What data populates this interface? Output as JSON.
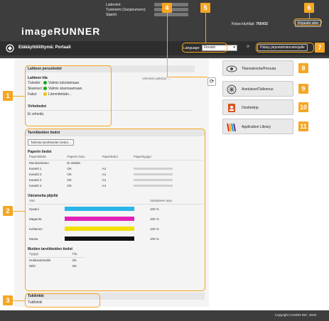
{
  "header": {
    "brand": "imageRUNNER",
    "device_info": [
      "Laitenimi:",
      "Tuotenimi (Sarjanumero):",
      "Sijainti:"
    ],
    "user_label": "Kirjaa käyttäjä:",
    "user_id": "765432",
    "logout_label": "Kirjaudu ulos",
    "portal_title": "Etäkäyttöliittymä: Portaali",
    "language_label": "Language:",
    "language_value": "Finnish",
    "help_label": "Pääsy järjestelmänvalvojalle",
    "refresh_label": "Viimeisin päivitys: ..."
  },
  "basic": {
    "title": "Laitteen perustiedot",
    "status_title": "Laitteen tila",
    "status": [
      {
        "name": "Tulostin:",
        "value": "Valmis tulostamaan.",
        "level": "ok"
      },
      {
        "name": "Skanneri:",
        "value": "Valmis skannaamaan.",
        "level": "ok"
      },
      {
        "name": "Faksi:",
        "value": "Lämmitetään...",
        "level": "warn"
      }
    ],
    "error_title": "Virhetiedot",
    "error_value": "Ei virheitä."
  },
  "supplies": {
    "title": "Tarvikkeiden tiedot",
    "check_button": "Tarkista tarvikkeiden tiedot...",
    "paper_title": "Paperin tiedot",
    "paper_headers": [
      "Paperilähde",
      "Paperin taso",
      "Paperikoko",
      "Paperityyppi"
    ],
    "paper_rows": [
      [
        "Monitoimitaso",
        "Ei mitään",
        "",
        ""
      ],
      [
        "Kasetti 1",
        "OK",
        "A4",
        ""
      ],
      [
        "Kasetti 2",
        "OK",
        "A4",
        ""
      ],
      [
        "Kasetti 3",
        "OK",
        "A4",
        ""
      ],
      [
        "Kasetti 4",
        "OK",
        "A4",
        ""
      ]
    ],
    "toner_title": "Väriainetta jäljellä",
    "toner_headers": [
      "Väri",
      "Väriaineen taso"
    ],
    "toner_rows": [
      {
        "name": "Syaani",
        "level": "100 %",
        "color": "#29b6e8"
      },
      {
        "name": "Magenta",
        "level": "100 %",
        "color": "#e020b8"
      },
      {
        "name": "Keltainen",
        "level": "100 %",
        "color": "#f2e000"
      },
      {
        "name": "Musta",
        "level": "100 %",
        "color": "#111111"
      }
    ],
    "other_title": "Muiden tarvikkeiden tiedot",
    "other_headers": [
      "Tyyppi",
      "Tila"
    ],
    "other_rows": [
      [
        "Hukkavärisäiliö",
        "OK"
      ],
      [
        "Niitit",
        "OK"
      ]
    ]
  },
  "contact": {
    "title": "Tukilinkki",
    "link": "Tukilinkki"
  },
  "menu": [
    {
      "label": "Tilanvalvonta/Peruuta",
      "icon": "eye-icon"
    },
    {
      "label": "Asetukset/Tallennus",
      "icon": "settings-icon"
    },
    {
      "label": "Osoitekirja",
      "icon": "address-book-icon"
    },
    {
      "label": "Application Library",
      "icon": "application-library-icon"
    }
  ],
  "footer": {
    "copyright": "Copyright CANON INC. 2019"
  },
  "callouts": [
    "1",
    "2",
    "3",
    "4",
    "5",
    "6",
    "7",
    "8",
    "9",
    "10",
    "11"
  ],
  "accent_color": "#f5a623"
}
